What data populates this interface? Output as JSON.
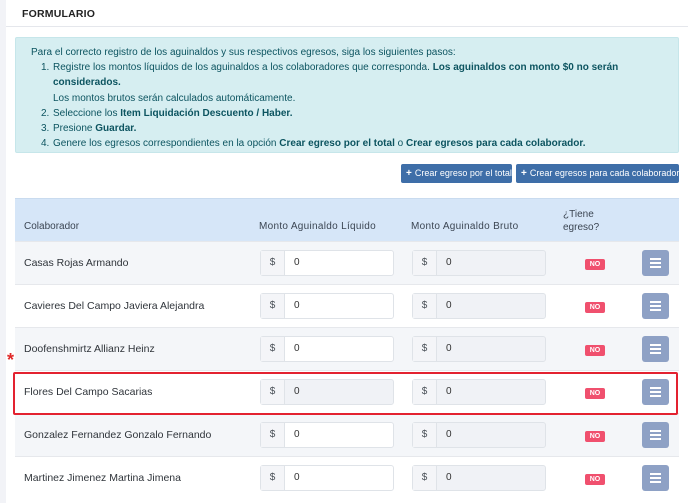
{
  "form": {
    "title": "FORMULARIO"
  },
  "instructions": {
    "intro": "Para el correcto registro de los aguinaldos y sus respectivos egresos, siga los siguientes pasos:",
    "step1_num": "1.",
    "step1_text": "Registre los montos líquidos de los aguinaldos a los colaboradores que corresponda.",
    "step1_bold": "Los aguinaldos con monto $0 no serán considerados.",
    "step1_line2": "Los montos brutos serán calculados automáticamente.",
    "step2_num": "2.",
    "step2_text": "Seleccione los",
    "step2_bold": "Item Liquidación Descuento / Haber.",
    "step3_num": "3.",
    "step3_text": "Presione",
    "step3_bold": "Guardar.",
    "step4_num": "4.",
    "step4_text": "Genere los egresos correspondientes en la opción",
    "step4_bold1": "Crear egreso por el total",
    "step4_mid": "o",
    "step4_bold2": "Crear egresos para cada colaborador."
  },
  "actions": {
    "create_total": "Crear egreso por el total",
    "create_each": "Crear egresos para cada colaborador"
  },
  "table": {
    "headers": {
      "colaborador": "Colaborador",
      "liquido": "Monto Aguinaldo Líquido",
      "bruto": "Monto Aguinaldo Bruto",
      "egreso": "¿Tiene egreso?"
    },
    "currency": "$",
    "rows": [
      {
        "name": "Casas Rojas Armando",
        "liquido": "0",
        "bruto": "0",
        "egreso": "NO"
      },
      {
        "name": "Cavieres Del Campo Javiera Alejandra",
        "liquido": "0",
        "bruto": "0",
        "egreso": "NO"
      },
      {
        "name": "Doofenshmirtz Allianz Heinz",
        "liquido": "0",
        "bruto": "0",
        "egreso": "NO"
      },
      {
        "name": "Flores Del Campo Sacarias",
        "liquido": "0",
        "bruto": "0",
        "egreso": "NO"
      },
      {
        "name": "Gonzalez Fernandez Gonzalo Fernando",
        "liquido": "0",
        "bruto": "0",
        "egreso": "NO"
      },
      {
        "name": "Martinez Jimenez Martina Jimena",
        "liquido": "0",
        "bruto": "0",
        "egreso": "NO"
      }
    ]
  },
  "annotation": {
    "marker": "*",
    "highlight_color": "#e32230"
  },
  "colors": {
    "primary_button": "#3e6ea8",
    "badge_no": "#f0506e",
    "menu_button": "#8ea1c5",
    "info_bg": "#d6eef1",
    "table_header_bg": "#d6e6f8"
  }
}
